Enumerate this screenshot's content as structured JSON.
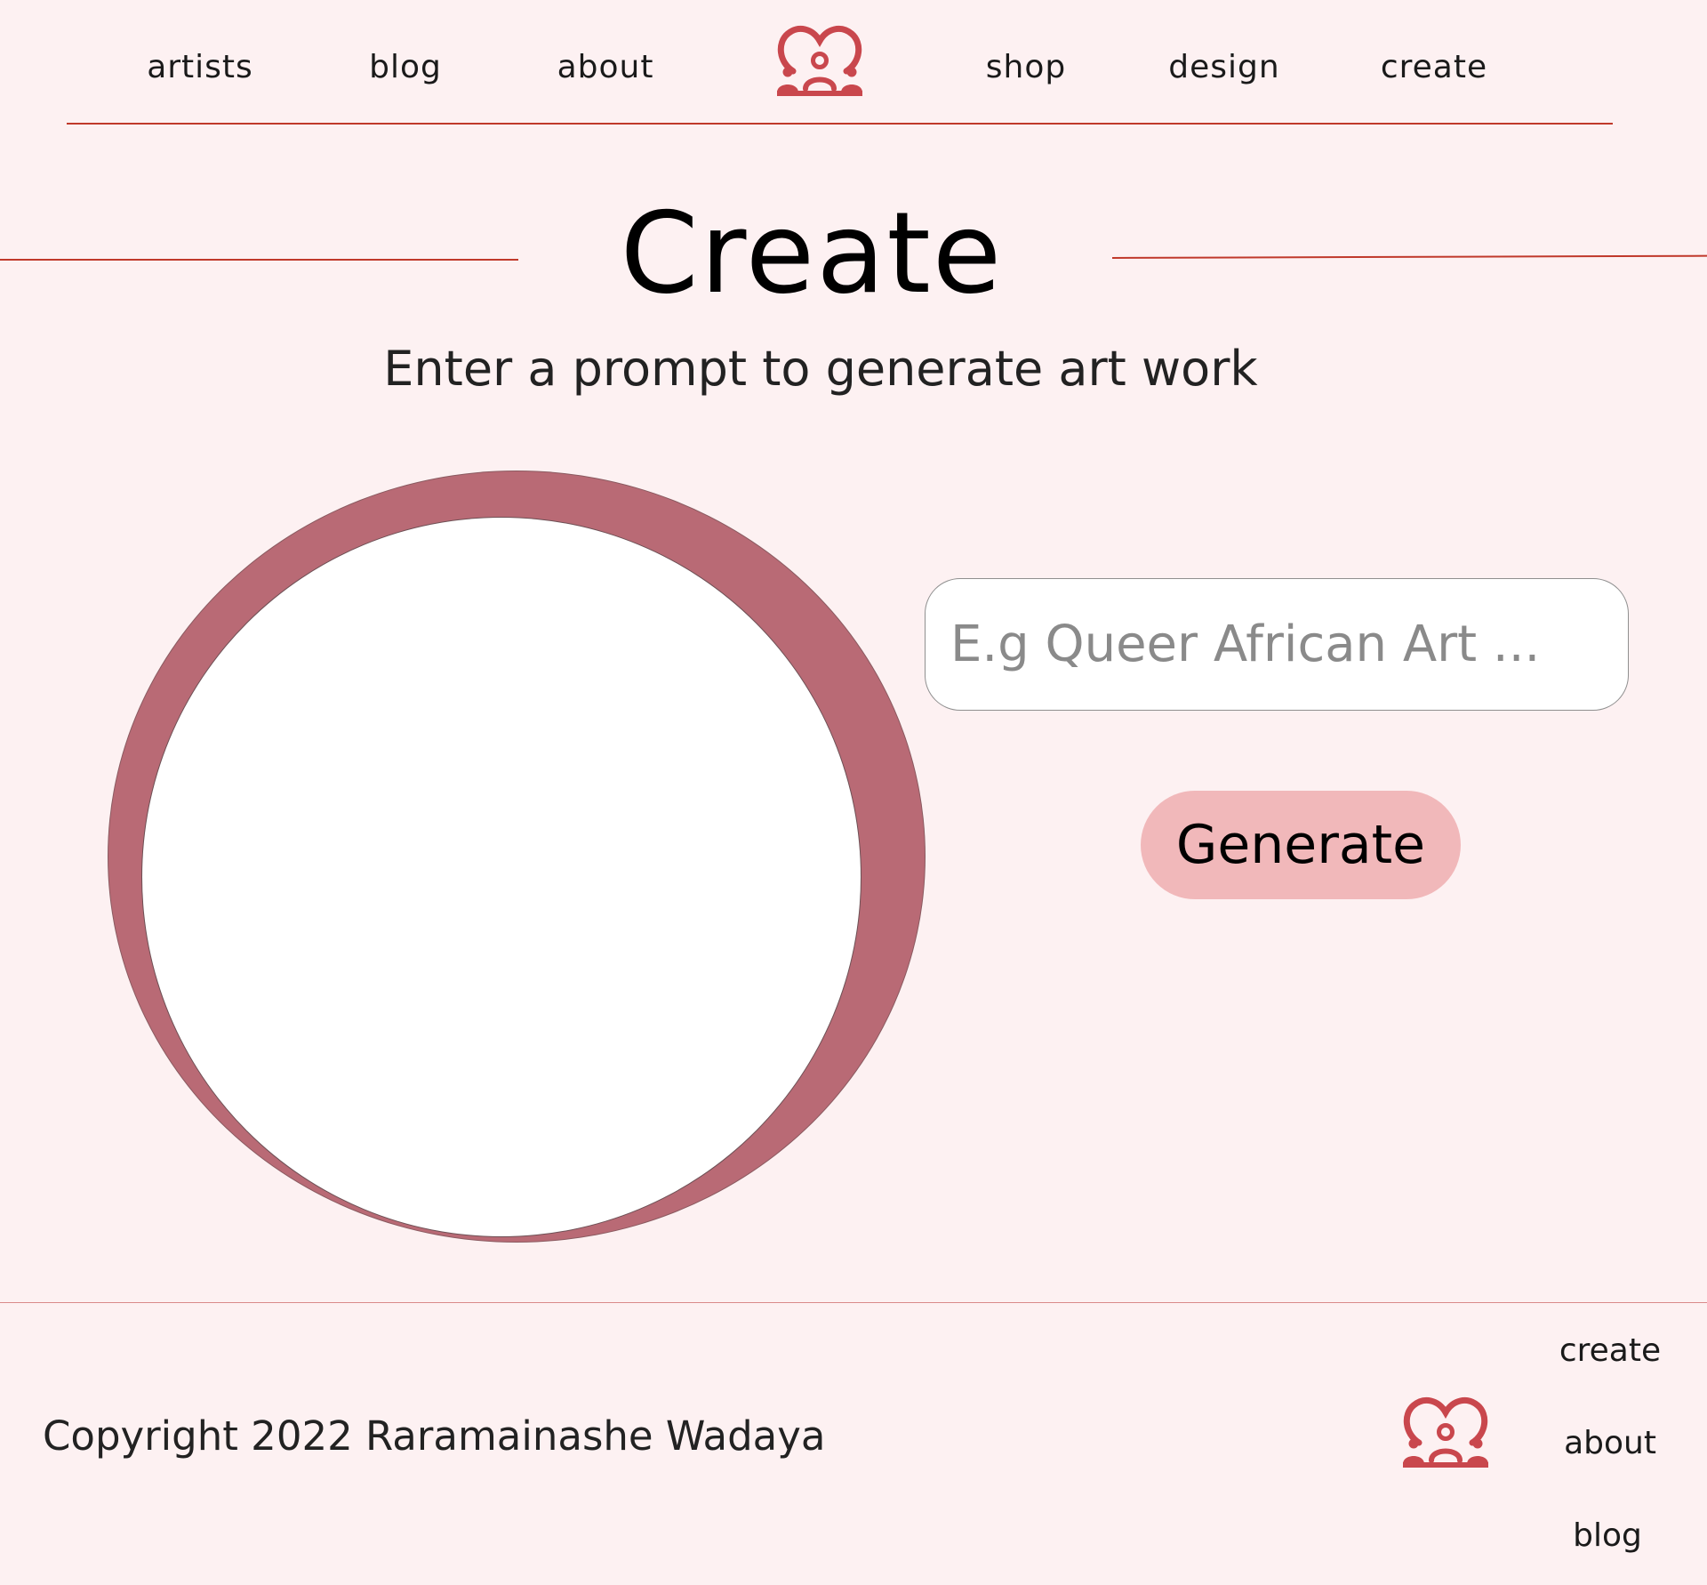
{
  "nav": {
    "links_left": [
      "artists",
      "blog",
      "about"
    ],
    "links_right": [
      "shop",
      "design",
      "create"
    ],
    "logo_icon": "heart-people-icon"
  },
  "page": {
    "title": "Create",
    "subtitle": "Enter a prompt to generate art work"
  },
  "prompt": {
    "placeholder": "E.g Queer African Art ...",
    "value": "",
    "generate_label": "Generate"
  },
  "footer": {
    "copyright": "Copyright 2022 Raramainashe Wadaya",
    "links": [
      "create",
      "about",
      "blog"
    ],
    "logo_icon": "heart-people-icon"
  },
  "colors": {
    "background": "#fdf1f2",
    "accent": "#c0392b",
    "logo": "#c9474d",
    "art_frame": "#b96a75",
    "button": "#f1b8ba"
  }
}
